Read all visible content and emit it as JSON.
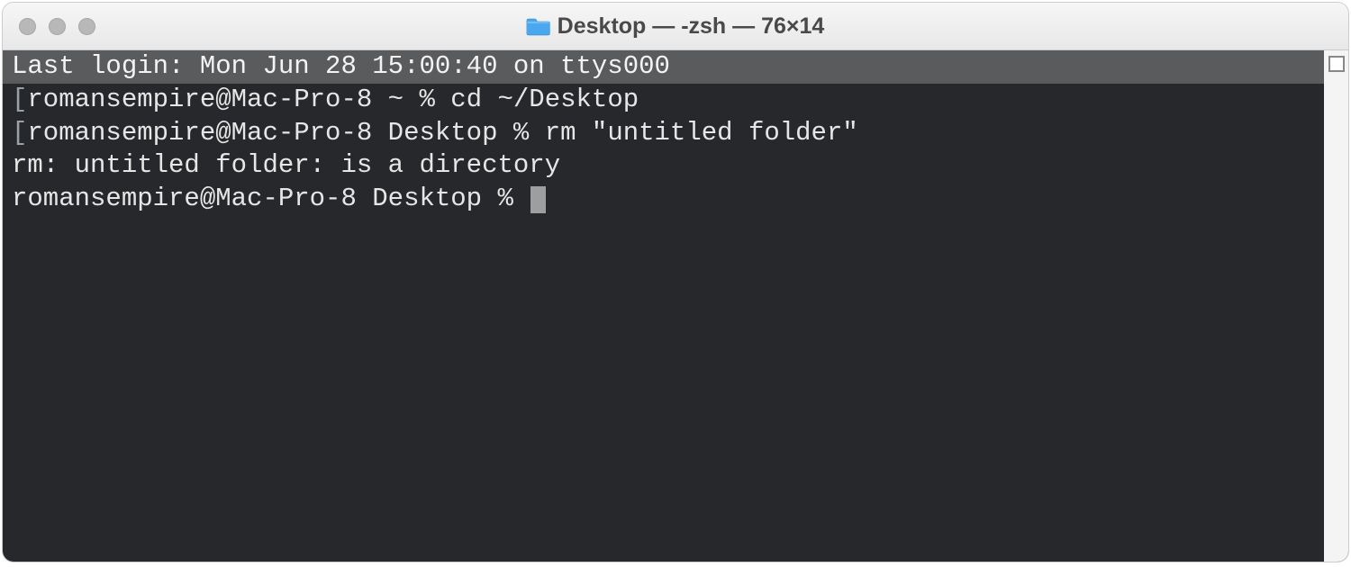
{
  "window": {
    "title": "Desktop — -zsh — 76×14"
  },
  "terminal": {
    "lines": {
      "last_login": "Last login: Mon Jun 28 15:00:40 on ttys000",
      "prompt1_user": "romansempire@Mac-Pro-8 ~ % ",
      "prompt1_cmd": "cd ~/Desktop",
      "prompt2_user": "romansempire@Mac-Pro-8 Desktop % ",
      "prompt2_cmd": "rm \"untitled folder\"",
      "error": "rm: untitled folder: is a directory",
      "prompt3_user": "romansempire@Mac-Pro-8 Desktop % "
    }
  }
}
